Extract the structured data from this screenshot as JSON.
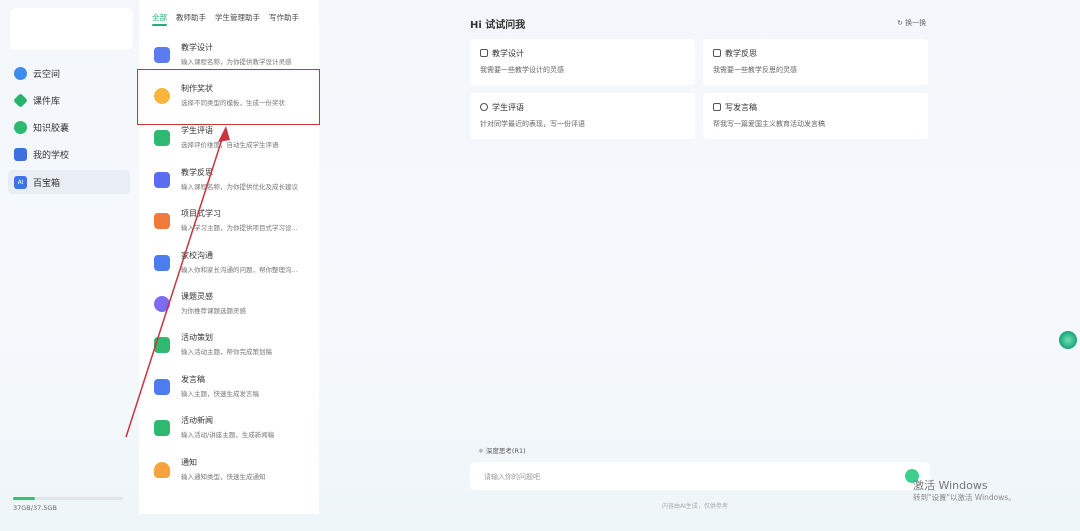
{
  "sidebar": {
    "items": [
      {
        "label": "云空间",
        "icon": "cloud-icon",
        "color": "#3d8cf0"
      },
      {
        "label": "课件库",
        "icon": "gem-icon",
        "color": "#26b36b"
      },
      {
        "label": "知识胶囊",
        "icon": "capsule-icon",
        "color": "#2fb870"
      },
      {
        "label": "我的学校",
        "icon": "school-icon",
        "color": "#3d6fe0"
      },
      {
        "label": "百宝箱",
        "icon": "ai-icon",
        "color": "#3d72e8"
      }
    ],
    "storage": {
      "text": "37GB/37.5GB",
      "used_fraction": 0.2
    }
  },
  "tools": {
    "tabs": [
      "全部",
      "教师助手",
      "学生管理助手",
      "写作助手"
    ],
    "items": [
      {
        "title": "教学设计",
        "desc": "输入课程名称，为你提供教学设计灵感",
        "icon": "document-icon",
        "color": "#5b7cf0"
      },
      {
        "title": "制作奖状",
        "desc": "选择不同类型的模板，生成一份奖状",
        "icon": "award-icon",
        "color": "#f6b73c"
      },
      {
        "title": "学生评语",
        "desc": "选择评价维度，自动生成学生评语",
        "icon": "student-icon",
        "color": "#2fb870"
      },
      {
        "title": "教学反思",
        "desc": "输入课程名称，为你提供优化及成长建议",
        "icon": "reflection-icon",
        "color": "#5b6cf0"
      },
      {
        "title": "项目式学习",
        "desc": "输入学习主题，为你提供项目式学习设...",
        "icon": "project-icon",
        "color": "#f07a3c"
      },
      {
        "title": "家校沟通",
        "desc": "输入你和家长沟通的问题，帮你整理沟...",
        "icon": "chat-icon",
        "color": "#4b7cf0"
      },
      {
        "title": "课题灵感",
        "desc": "为你推荐课题选题灵感",
        "icon": "bulb-icon",
        "color": "#7b6cf0"
      },
      {
        "title": "活动策划",
        "desc": "输入活动主题，帮你完成策划稿",
        "icon": "flag-icon",
        "color": "#2fb870"
      },
      {
        "title": "发言稿",
        "desc": "输入主题，快速生成发言稿",
        "icon": "speech-icon",
        "color": "#4b7cf0"
      },
      {
        "title": "活动新闻",
        "desc": "输入活动/讲座主题，生成新闻稿",
        "icon": "news-icon",
        "color": "#2fb870"
      },
      {
        "title": "通知",
        "desc": "输入通知类型，快速生成通知",
        "icon": "bell-icon",
        "color": "#f6a33c"
      }
    ]
  },
  "main": {
    "title": "Hi 试试问我",
    "refresh_label": "换一换",
    "cards": [
      {
        "title": "教学设计",
        "desc": "我需要一些教学设计的灵感"
      },
      {
        "title": "教学反思",
        "desc": "我需要一些教学反思的灵感"
      },
      {
        "title": "学生评语",
        "desc": "针对同学最近的表现，写一份评语"
      },
      {
        "title": "写发言稿",
        "desc": "帮我写一篇爱国主义教育活动发言稿"
      }
    ],
    "think_label": "深度思考(R1)",
    "input_placeholder": "请输入你的问题吧",
    "disclaimer": "内容由AI生成，仅供参考"
  },
  "overlay": {
    "activate_title": "激活 Windows",
    "activate_sub": "转到\"设置\"以激活 Windows。",
    "highlight_color": "#c8343f"
  }
}
